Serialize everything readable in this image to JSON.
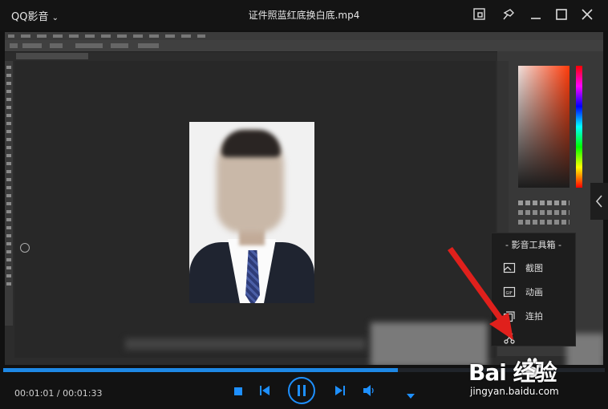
{
  "app": {
    "name": "QQ影音",
    "menu_chevron": "chevron-down-icon"
  },
  "window": {
    "title": "证件照蓝红底换白底.mp4"
  },
  "title_buttons": [
    "screenshot-icon",
    "pin-icon",
    "minimize-icon",
    "maximize-icon",
    "close-icon"
  ],
  "toolbox": {
    "title": "- 影音工具箱 -",
    "items": [
      {
        "label": "截图",
        "icon": "screenshot-icon"
      },
      {
        "label": "动画",
        "icon": "gif-icon"
      },
      {
        "label": "连拍",
        "icon": "burst-icon"
      },
      {
        "label": "",
        "icon": "scissors-icon"
      }
    ]
  },
  "playback": {
    "current_time": "00:01:01",
    "duration": "00:01:33",
    "time_display": "00:01:01 / 00:01:33",
    "progress": 0.656
  },
  "controls": [
    "stop-icon",
    "previous-icon",
    "pause-icon",
    "next-icon",
    "volume-icon",
    "more-icon"
  ],
  "watermark": {
    "brand": "Bai  经验",
    "url": "jingyan.baidu.com"
  },
  "colors": {
    "accent": "#1e88e5",
    "arrow": "#e0201c",
    "background": "#111111"
  }
}
